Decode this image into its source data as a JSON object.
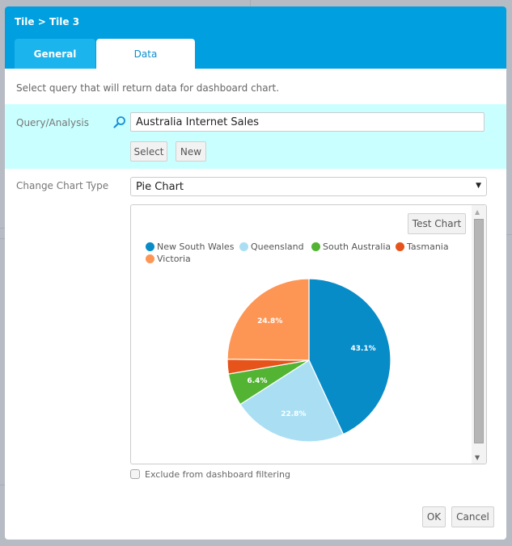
{
  "dialog": {
    "title": "Tile > Tile 3",
    "tabs": [
      {
        "label": "General",
        "active": false
      },
      {
        "label": "Data",
        "active": true
      }
    ],
    "intro": "Select query that will return data for dashboard chart.",
    "query": {
      "label": "Query/Analysis",
      "value": "Australia Internet Sales",
      "select_label": "Select",
      "new_label": "New"
    },
    "chart_type": {
      "label": "Change Chart Type",
      "selected": "Pie Chart"
    },
    "test_chart_label": "Test Chart",
    "exclude_label": "Exclude from dashboard filtering",
    "exclude_checked": false,
    "ok_label": "OK",
    "cancel_label": "Cancel"
  },
  "colors": {
    "header": "#009fdf",
    "query_band": "#caffff"
  },
  "chart_data": {
    "type": "pie",
    "title": "",
    "categories": [
      "New South Wales",
      "Queensland",
      "South Australia",
      "Tasmania",
      "Victoria"
    ],
    "values": [
      43.1,
      22.8,
      6.4,
      2.9,
      24.8
    ],
    "labels": [
      "43.1%",
      "22.8%",
      "6.4%",
      "",
      "24.8%"
    ],
    "colors": [
      "#078cc8",
      "#aadff3",
      "#52b432",
      "#e6541b",
      "#fd9655"
    ],
    "legend": "top-left",
    "start_angle": "12 o'clock",
    "direction": "clockwise"
  }
}
